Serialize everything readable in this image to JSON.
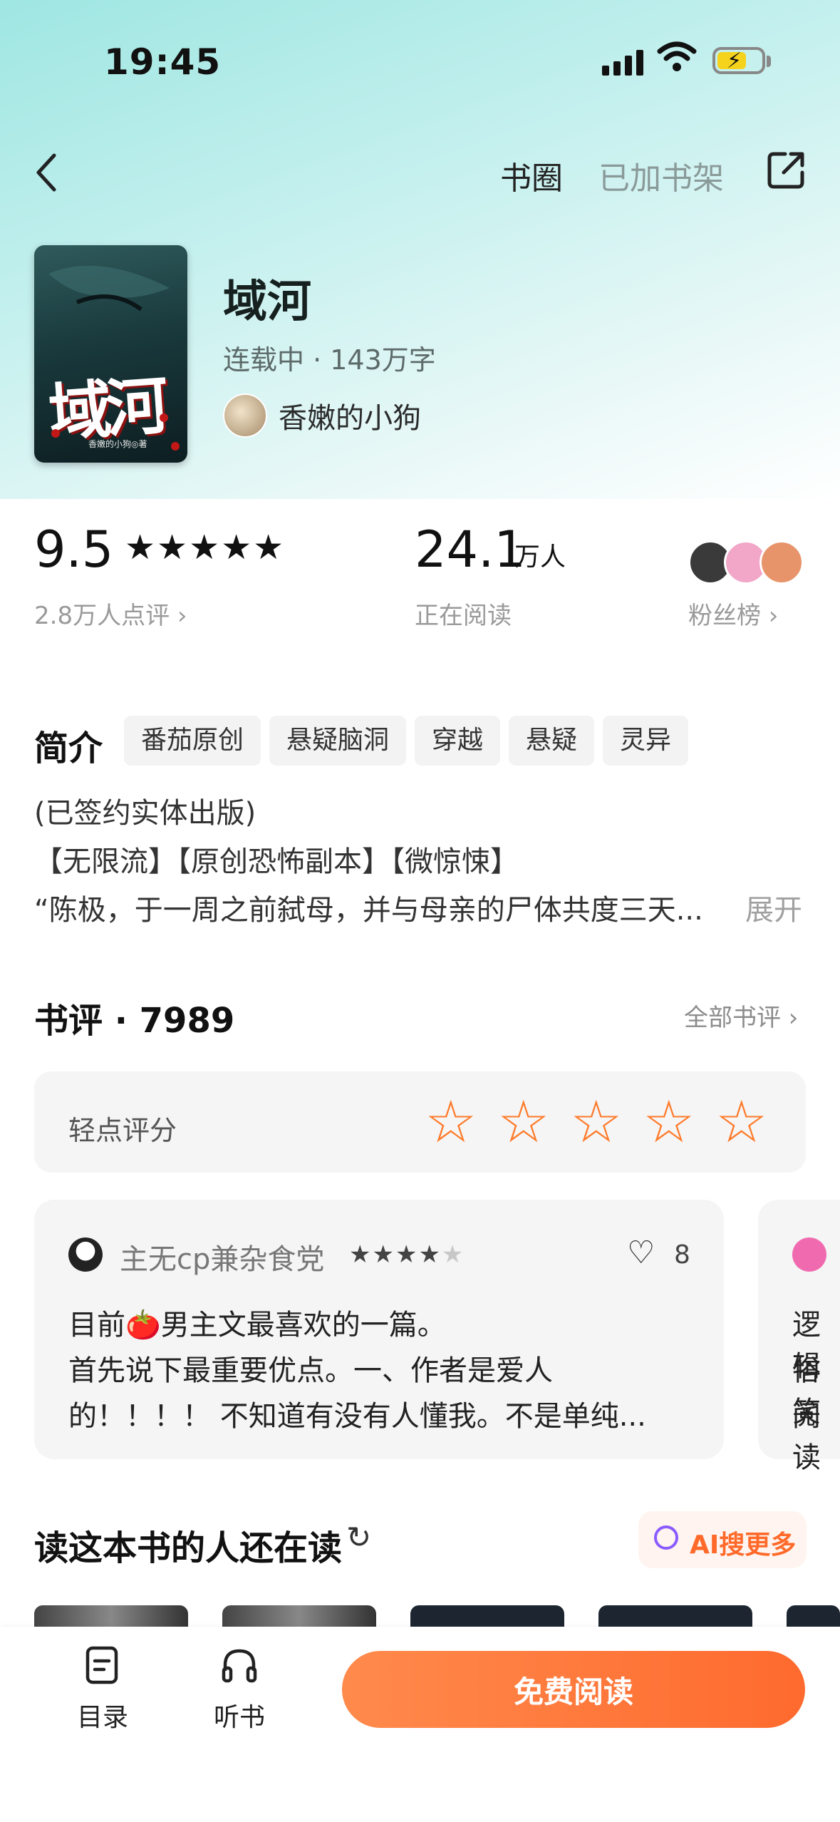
{
  "status": {
    "time": "19:45"
  },
  "nav": {
    "circle": "书圈",
    "shelf": "已加书架"
  },
  "book": {
    "cover_title": "域河",
    "cover_author": "香嫩的小狗◎著",
    "title": "域河",
    "meta": "连载中 · 143万字",
    "author": "香嫩的小狗"
  },
  "stats": {
    "rating": "9.5",
    "rating_stars": "★★★★★",
    "rating_count": "2.8万人点评 ›",
    "readers": "24.1",
    "readers_unit": "万人",
    "readers_label": "正在阅读",
    "fans_label": "粉丝榜 ›"
  },
  "intro": {
    "title": "简介",
    "tags": [
      "番茄原创",
      "悬疑脑洞",
      "穿越",
      "悬疑",
      "灵异"
    ],
    "lines": [
      "(已签约实体出版)",
      "【无限流】【原创恐怖副本】【微惊悚】",
      "“陈极，于一周之前弑母，并与母亲的尸体共度三天..."
    ],
    "expand": "展开"
  },
  "reviews": {
    "title": "书评 · 7989",
    "all": "全部书评 ›",
    "rate_label": "轻点评分",
    "rate_star": "☆",
    "first": {
      "user": "主无cp兼杂食党",
      "stars": "★★★★★",
      "likes": "8",
      "lines": [
        "目前🍅男主文最喜欢的一篇。",
        "首先说下最重要优点。一、作者是爱人",
        "的！！！！ 不知道有没有人懂我。不是单纯..."
      ]
    },
    "peek_lines": [
      "逻辑",
      "俗笑",
      "阅读"
    ]
  },
  "more": {
    "title": "读这本书的人还在读",
    "refresh_icon": "↻",
    "ai_button": "AI搜更多"
  },
  "bottom": {
    "toc": "目录",
    "listen": "听书",
    "read": "免费阅读"
  },
  "colors": {
    "accent": "#ff6a2e",
    "hero": "#9fe6e2"
  }
}
